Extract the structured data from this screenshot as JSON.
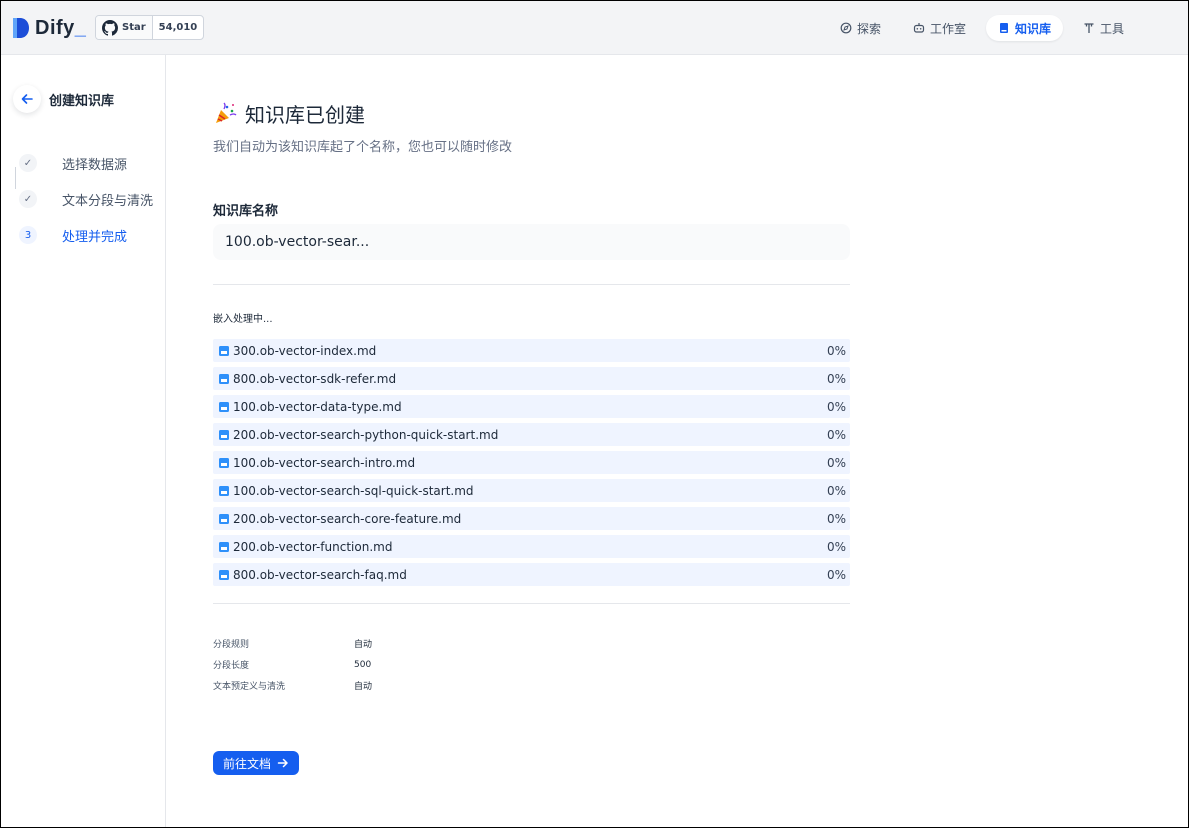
{
  "header": {
    "logo_text": "Dify",
    "github": {
      "label": "Star",
      "count": "54,010"
    },
    "nav": [
      {
        "label": "探索",
        "icon": "compass-icon",
        "active": false
      },
      {
        "label": "工作室",
        "icon": "robot-icon",
        "active": false
      },
      {
        "label": "知识库",
        "icon": "book-icon",
        "active": true
      },
      {
        "label": "工具",
        "icon": "tools-icon",
        "active": false
      }
    ]
  },
  "sidebar": {
    "title": "创建知识库",
    "steps": [
      {
        "marker": "✓",
        "label": "选择数据源",
        "state": "done"
      },
      {
        "marker": "✓",
        "label": "文本分段与清洗",
        "state": "done"
      },
      {
        "marker": "3",
        "label": "处理并完成",
        "state": "current"
      }
    ]
  },
  "main": {
    "title": "知识库已创建",
    "subtitle": "我们自动为该知识库起了个名称，您也可以随时修改",
    "name_label": "知识库名称",
    "name_value": "100.ob-vector-sear...",
    "processing_label": "嵌入处理中...",
    "files": [
      {
        "name": "300.ob-vector-index.md",
        "percent": "0%"
      },
      {
        "name": "800.ob-vector-sdk-refer.md",
        "percent": "0%"
      },
      {
        "name": "100.ob-vector-data-type.md",
        "percent": "0%"
      },
      {
        "name": "200.ob-vector-search-python-quick-start.md",
        "percent": "0%"
      },
      {
        "name": "100.ob-vector-search-intro.md",
        "percent": "0%"
      },
      {
        "name": "100.ob-vector-search-sql-quick-start.md",
        "percent": "0%"
      },
      {
        "name": "200.ob-vector-search-core-feature.md",
        "percent": "0%"
      },
      {
        "name": "200.ob-vector-function.md",
        "percent": "0%"
      },
      {
        "name": "800.ob-vector-search-faq.md",
        "percent": "0%"
      }
    ],
    "rules": [
      {
        "key": "分段规则",
        "value": "自动"
      },
      {
        "key": "分段长度",
        "value": "500"
      },
      {
        "key": "文本预定义与清洗",
        "value": "自动"
      }
    ],
    "goto_button": "前往文档"
  },
  "colors": {
    "accent": "#155eef",
    "progress_bg": "#eff4ff"
  }
}
